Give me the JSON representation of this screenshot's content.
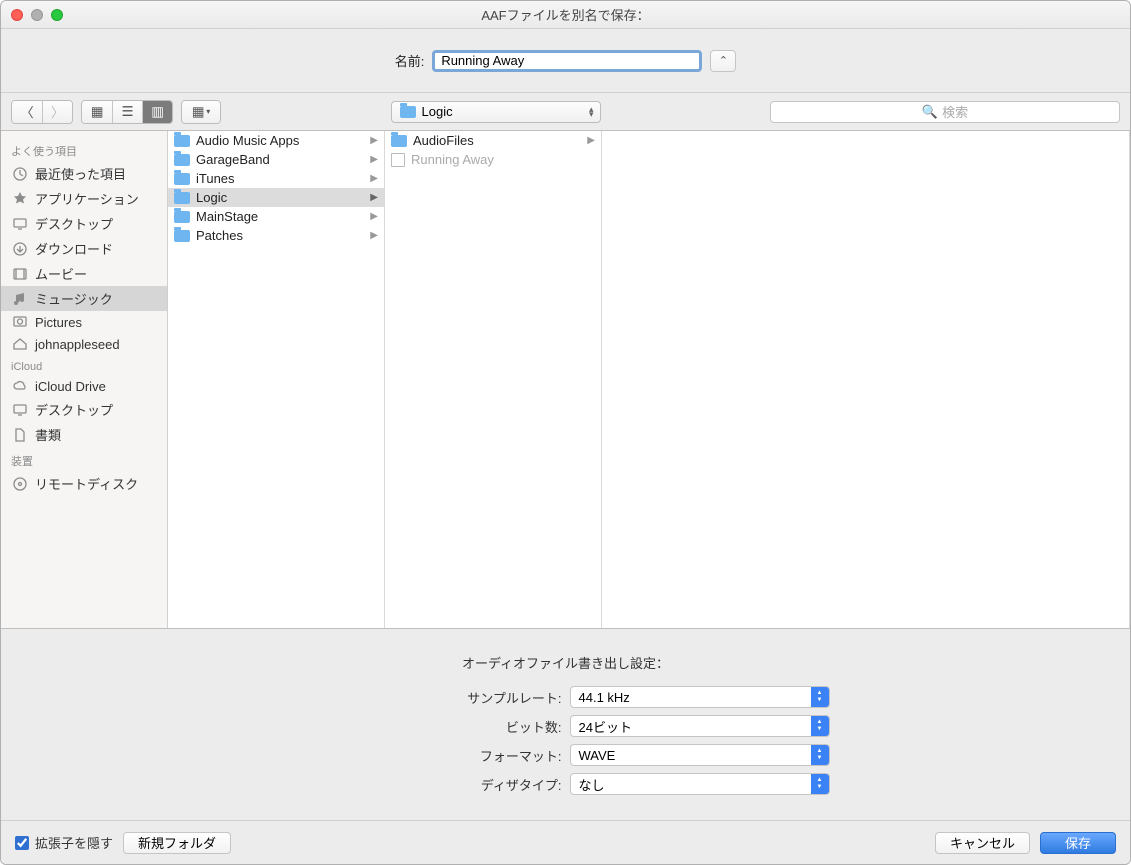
{
  "window": {
    "title": "AAFファイルを別名で保存："
  },
  "name": {
    "label": "名前:",
    "value": "Running Away"
  },
  "toolbar": {
    "path_folder": "Logic",
    "search_placeholder": "検索"
  },
  "sidebar": {
    "section_favorites": "よく使う項目",
    "section_icloud": "iCloud",
    "section_devices": "装置",
    "favorites": [
      {
        "label": "最近使った項目"
      },
      {
        "label": "アプリケーション"
      },
      {
        "label": "デスクトップ"
      },
      {
        "label": "ダウンロード"
      },
      {
        "label": "ムービー"
      },
      {
        "label": "ミュージック"
      },
      {
        "label": "Pictures"
      },
      {
        "label": "johnappleseed"
      }
    ],
    "icloud": [
      {
        "label": "iCloud Drive"
      },
      {
        "label": "デスクトップ"
      },
      {
        "label": "書類"
      }
    ],
    "devices": [
      {
        "label": "リモートディスク"
      }
    ]
  },
  "col1": [
    {
      "label": "Audio Music Apps"
    },
    {
      "label": "GarageBand"
    },
    {
      "label": "iTunes"
    },
    {
      "label": "Logic"
    },
    {
      "label": "MainStage"
    },
    {
      "label": "Patches"
    }
  ],
  "col2": [
    {
      "label": "AudioFiles",
      "type": "folder"
    },
    {
      "label": "Running Away",
      "type": "file"
    }
  ],
  "settings": {
    "title": "オーディオファイル書き出し設定：",
    "sample_rate_label": "サンプルレート:",
    "sample_rate_value": "44.1 kHz",
    "bit_label": "ビット数:",
    "bit_value": "24ビット",
    "format_label": "フォーマット:",
    "format_value": "WAVE",
    "dither_label": "ディザタイプ:",
    "dither_value": "なし"
  },
  "bottom": {
    "hide_ext": "拡張子を隠す",
    "new_folder": "新規フォルダ",
    "cancel": "キャンセル",
    "save": "保存"
  }
}
